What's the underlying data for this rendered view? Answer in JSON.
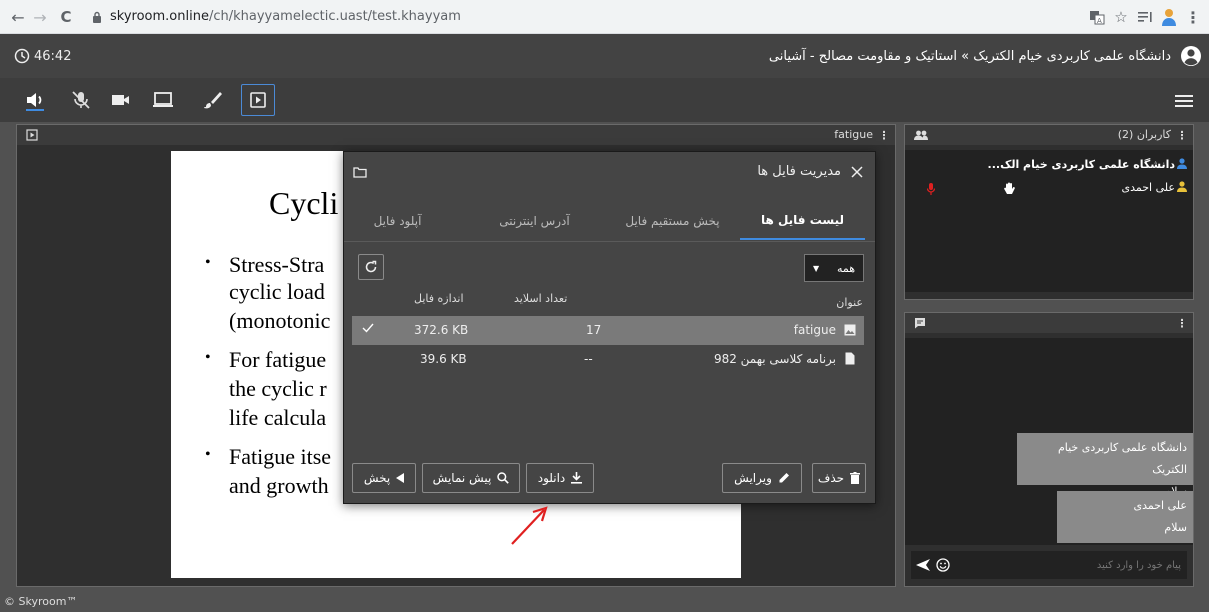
{
  "browser": {
    "url_host": "skyroom.online",
    "url_path": "/ch/khayyamelectic.uast/test.khayyam",
    "nav_back": "←",
    "nav_forward": "→",
    "nav_reload": "C"
  },
  "header": {
    "timer": "46:42",
    "title": "دانشگاه علمی کاربردی خیام الکتریک » استاتیک و مقاومت مصالح - آشیانی"
  },
  "toolbar": {
    "items": [
      {
        "icon": "speaker-icon",
        "active": true
      },
      {
        "icon": "mic-off-icon",
        "active": false
      },
      {
        "icon": "camera-icon",
        "active": false
      },
      {
        "icon": "screen-share-icon",
        "active": false
      },
      {
        "icon": "brush-icon",
        "active": false
      },
      {
        "icon": "presentation-icon",
        "active": true
      }
    ],
    "menu_icon": "hamburger-icon"
  },
  "presentation": {
    "panel_label": "fatigue",
    "slide": {
      "title": "Cycli",
      "lines": [
        {
          "bullet": true,
          "text": "Stress-Stra"
        },
        {
          "bullet": false,
          "text": "cyclic load"
        },
        {
          "bullet": false,
          "text": "(monotonic"
        },
        {
          "bullet": true,
          "text": "For fatigue"
        },
        {
          "bullet": false,
          "text": "the cyclic r"
        },
        {
          "bullet": false,
          "text": "life calcula"
        },
        {
          "bullet": true,
          "text": "Fatigue itse"
        },
        {
          "bullet": false,
          "text": "and growth"
        }
      ]
    }
  },
  "file_dialog": {
    "title": "مدیریت فایل ها",
    "tabs": [
      {
        "label": "لیست فایل ها",
        "selected": true
      },
      {
        "label": "پخش مستقیم فایل",
        "selected": false
      },
      {
        "label": "آدرس اینترنتی",
        "selected": false
      },
      {
        "label": "آپلود فایل",
        "selected": false
      }
    ],
    "filter_value": "همه",
    "columns": {
      "title": "عنوان",
      "slides": "تعداد اسلاید",
      "size": "اندازه فایل"
    },
    "rows": [
      {
        "title": "fatigue",
        "slides": "17",
        "size": "372.6 KB",
        "selected": true,
        "icon": "image-file-icon"
      },
      {
        "title": "برنامه کلاسی بهمن 982",
        "slides": "--",
        "size": "39.6 KB",
        "selected": false,
        "icon": "document-file-icon"
      }
    ],
    "buttons": {
      "delete": "حذف",
      "edit": "ویرایش",
      "download": "دانلود",
      "preview": "پیش نمایش",
      "play": "پخش"
    }
  },
  "users_panel": {
    "title": "کاربران (2)",
    "users": [
      {
        "name": "دانشگاه علمی کاربردی خیام الک...",
        "bold": true,
        "icon_color": "#3f8be0"
      },
      {
        "name": "علی احمدی",
        "bold": false,
        "icon_color": "#e8c13a"
      }
    ]
  },
  "chat_panel": {
    "messages": [
      {
        "sender": "دانشگاه علمی کاربردی خیام الکتریک",
        "text": "سلام"
      },
      {
        "sender": "علی احمدی",
        "text": "سلام"
      }
    ],
    "input_placeholder": "پیام خود را وارد کنید"
  },
  "footer": {
    "text": "© Skyroom™"
  },
  "colors": {
    "accent": "#3f8be0",
    "annotation_arrow": "#e02020",
    "mic_red": "#e02020"
  }
}
